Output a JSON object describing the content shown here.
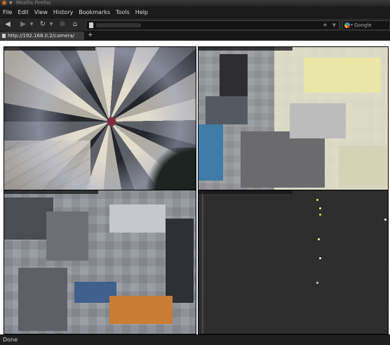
{
  "window": {
    "title": "Mozilla Firefox"
  },
  "menubar": {
    "items": [
      {
        "label": "File"
      },
      {
        "label": "Edit"
      },
      {
        "label": "View"
      },
      {
        "label": "History"
      },
      {
        "label": "Bookmarks"
      },
      {
        "label": "Tools"
      },
      {
        "label": "Help"
      }
    ]
  },
  "navbar": {
    "search_placeholder": "Google",
    "search_engine": "google-icon"
  },
  "tabs": [
    {
      "label": "http://192.168.0.2/camera/",
      "active": true
    }
  ],
  "content": {
    "cameras": [
      {
        "id": "camera-1",
        "style": "swirl"
      },
      {
        "id": "camera-2",
        "style": "pixelate"
      },
      {
        "id": "camera-3",
        "style": "pixelate"
      },
      {
        "id": "camera-4",
        "style": "night"
      }
    ]
  },
  "statusbar": {
    "text": "Done"
  },
  "colors": {
    "chrome_dark": "#1e1e1e",
    "menubar": "#1b1b1b",
    "tab_active": "#3b3b3b",
    "page_background": "#ffffff"
  }
}
